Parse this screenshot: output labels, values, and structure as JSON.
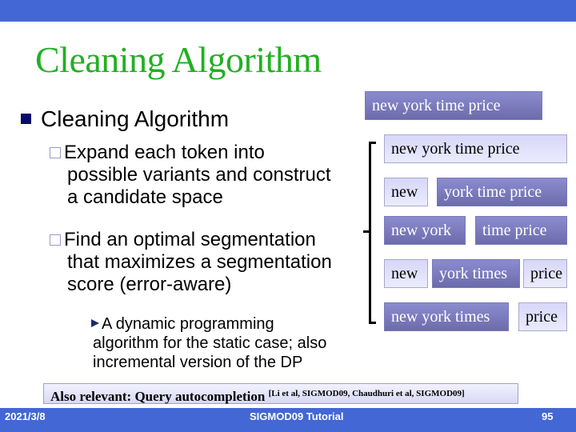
{
  "slide": {
    "title": "Cleaning Algorithm",
    "bullet1": "Cleaning Algorithm",
    "sub1": [
      "Expand each token into",
      "possible variants and construct",
      "a candidate space"
    ],
    "sub2": [
      "Find an optimal segmentation",
      "that maximizes a segmentation",
      "score (error-aware)"
    ],
    "subsub": [
      "A dynamic programming",
      "algorithm for the static case; also",
      "incremental version of the DP"
    ]
  },
  "query_box": "new york time price",
  "segmentations": [
    [
      {
        "text": "new york time price",
        "style": "light"
      }
    ],
    [
      {
        "text": "new",
        "style": "light"
      },
      {
        "text": "york time price",
        "style": "dark"
      }
    ],
    [
      {
        "text": "new york",
        "style": "dark"
      },
      {
        "text": "time price",
        "style": "dark"
      }
    ],
    [
      {
        "text": "new",
        "style": "light"
      },
      {
        "text": "york times",
        "style": "dark"
      },
      {
        "text": "price",
        "style": "light"
      }
    ],
    [
      {
        "text": "new york times",
        "style": "dark"
      },
      {
        "text": "price",
        "style": "light"
      }
    ]
  ],
  "note": {
    "main": "Also relevant: Query autocompletion ",
    "citation": "[Li et al, SIGMOD09, Chaudhuri et al, SIGMOD09]"
  },
  "footer": {
    "date": "2021/3/8",
    "center": "SIGMOD09 Tutorial",
    "page": "95"
  },
  "colors": {
    "bar": "#4367d4",
    "title": "#22b022",
    "light_box": "#e0e0fc",
    "dark_box": "#7a7abc"
  }
}
